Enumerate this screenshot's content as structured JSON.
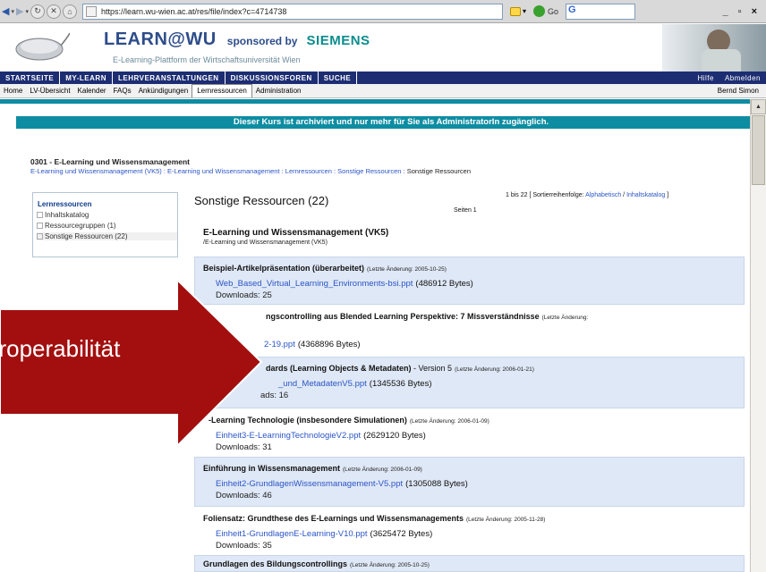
{
  "browser": {
    "url": "https://learn.wu-wien.ac.at/res/file/index?c=4714738",
    "go_label": "Go",
    "search_value": "G",
    "window_controls": "_ ▫ ×"
  },
  "banner": {
    "logo_text": "LEARN@WU",
    "sponsored_text": "sponsored by",
    "sponsor_name": "SIEMENS",
    "subtitle": "E-Learning-Plattform der Wirtschaftsuniversität Wien"
  },
  "nav_main": {
    "items": [
      "STARTSEITE",
      "MY-LEARN",
      "LEHRVERANSTALTUNGEN",
      "DISKUSSIONSFOREN",
      "SUCHE"
    ],
    "right": [
      "Hilfe",
      "Abmelden"
    ]
  },
  "nav_sub": {
    "items": [
      "Home",
      "LV-Übersicht",
      "Kalender",
      "FAQs",
      "Ankündigungen",
      "Lernressourcen",
      "Administration"
    ],
    "active": "Lernressourcen",
    "user": "Bernd Simon"
  },
  "notice": "Dieser Kurs ist archiviert und nur mehr für Sie als AdministratorIn zugänglich.",
  "course": {
    "title": "0301 - E-Learning und Wissensmanagement",
    "breadcrumb": [
      "E-Learning und Wissensmanagement (VK5)",
      "E-Learning und Wissensmanagement",
      "Lernressourcen",
      "Sonstige Ressourcen"
    ],
    "breadcrumb_current": "Sonstige Ressourcen",
    "separator": " : "
  },
  "sidebar": {
    "heading": "Lernressourcen",
    "items": [
      "Inhaltskatalog",
      "Ressourcegruppen (1)",
      "Sonstige Ressourcen (22)"
    ]
  },
  "main": {
    "title": "Sonstige Ressourcen (22)",
    "pages": "Seiten  1",
    "sort_prefix": "1 bis 22 [ Sortierreihenfolge:",
    "sort_alpha": "Alphabetisch",
    "sort_sep": " / ",
    "sort_catalog": "Inhaltskatalog",
    "sort_suffix": " ]",
    "category_heading": "E-Learning und Wissensmanagement (VK5)",
    "category_path": "/E-Learning und Wissensmanagement (VK5)"
  },
  "resources": [
    {
      "title": "Beispiel-Artikelpräsentation (überarbeitet)",
      "meta": "(Letzte Änderung: 2005-10-25)",
      "file": "Web_Based_Virtual_Learning_Environments-bsi.ppt",
      "size": "(486912 Bytes)",
      "downloads": "Downloads: 25"
    },
    {
      "title": "ngscontrolling aus Blended Learning Perspektive: 7 Missverständnisse",
      "meta": "(Letzte Änderung:",
      "file": "2-19.ppt",
      "size": "(4368896 Bytes)",
      "downloads": ""
    },
    {
      "title": "dards (Learning Objects & Metadaten)",
      "title_suffix": " - Version 5",
      "meta": "(Letzte Änderung: 2006-01-21)",
      "file": "_und_MetadatenV5.ppt",
      "size": "(1345536 Bytes)",
      "downloads": "ads: 16"
    },
    {
      "title": "-Learning Technologie (insbesondere Simulationen)",
      "meta": "(Letzte Änderung: 2006-01-09)",
      "file": "Einheit3-E-LearningTechnologieV2.ppt",
      "size": "(2629120 Bytes)",
      "downloads": "Downloads: 31"
    },
    {
      "title": "Einführung in Wissensmanagement",
      "meta": "(Letzte Änderung: 2006-01-09)",
      "file": "Einheit2-GrundlagenWissensmanagement-V5.ppt",
      "size": "(1305088 Bytes)",
      "downloads": "Downloads: 46"
    },
    {
      "title": "Foliensatz: Grundthese des E-Learnings und Wissensmanagements",
      "meta": "(Letzte Änderung: 2005-11-28)",
      "file": "Einheit1-GrundlagenE-Learning-V10.ppt",
      "size": "(3625472 Bytes)",
      "downloads": "Downloads: 35"
    },
    {
      "title": "Grundlagen des Bildungscontrollings",
      "meta": "(Letzte Änderung: 2005-10-25)",
      "file": "",
      "size": "",
      "downloads": ""
    }
  ],
  "overlay": {
    "arrow_text": "eroperabilität",
    "arrow_color": "#a30f0f"
  }
}
